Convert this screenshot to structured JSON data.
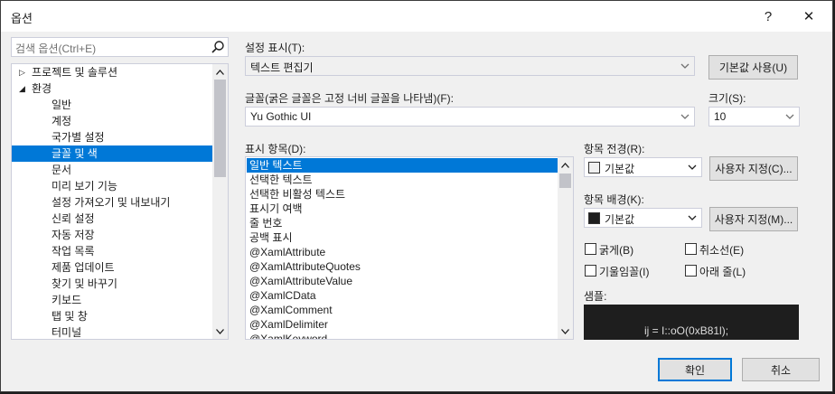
{
  "dialog": {
    "title": "옵션",
    "help_label": "?",
    "close_label": "✕"
  },
  "search": {
    "placeholder": "검색 옵션(Ctrl+E)"
  },
  "tree": {
    "items": [
      {
        "label": "프로젝트 및 솔루션",
        "expander": "▷"
      },
      {
        "label": "환경",
        "expander": "◢"
      },
      {
        "label": "일반"
      },
      {
        "label": "계정"
      },
      {
        "label": "국가별 설정"
      },
      {
        "label": "글꼴 및 색"
      },
      {
        "label": "문서"
      },
      {
        "label": "미리 보기 기능"
      },
      {
        "label": "설정 가져오기 및 내보내기"
      },
      {
        "label": "신뢰 설정"
      },
      {
        "label": "자동 저장"
      },
      {
        "label": "작업 목록"
      },
      {
        "label": "제품 업데이트"
      },
      {
        "label": "찾기 및 바꾸기"
      },
      {
        "label": "키보드"
      },
      {
        "label": "탭 및 창"
      },
      {
        "label": "터미널"
      }
    ],
    "selected_index": 5
  },
  "settings": {
    "show_label": "설정 표시(T):",
    "show_value": "텍스트 편집기",
    "use_defaults_label": "기본값 사용(U)",
    "font_label": "글꼴(굵은 글꼴은 고정 너비 글꼴을 나타냄)(F):",
    "font_value": "Yu Gothic UI",
    "size_label": "크기(S):",
    "size_value": "10",
    "display_items_label": "표시 항목(D):",
    "display_items": [
      "일반 텍스트",
      "선택한 텍스트",
      "선택한 비활성 텍스트",
      "표시기 여백",
      "줄 번호",
      "공백 표시",
      "@XamlAttribute",
      "@XamlAttributeQuotes",
      "@XamlAttributeValue",
      "@XamlCData",
      "@XamlComment",
      "@XamlDelimiter",
      "@XamlKeyword"
    ],
    "display_selected_index": 0,
    "foreground_label": "항목 전경(R):",
    "foreground_value": "기본값",
    "foreground_custom_label": "사용자 지정(C)...",
    "background_label": "항목 배경(K):",
    "background_value": "기본값",
    "background_custom_label": "사용자 지정(M)...",
    "bold_label": "굵게(B)",
    "strikethrough_label": "취소선(E)",
    "italic_label": "기울임꼴(I)",
    "underline_label": "아래 줄(L)",
    "sample_label": "샘플:",
    "sample_text": "ij = I::oO(0xB81l);"
  },
  "footer": {
    "ok_label": "확인",
    "cancel_label": "취소"
  },
  "colors": {
    "selection": "#0078d7",
    "sample_background": "#1e1e1e",
    "foreground_swatch": "#f0f0f0",
    "background_swatch": "#1e1e1e"
  }
}
